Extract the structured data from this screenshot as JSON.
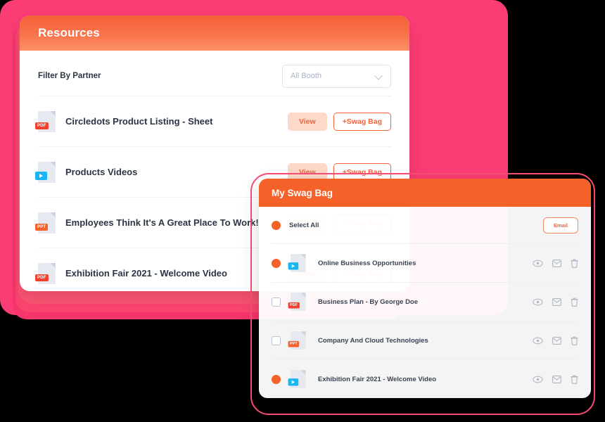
{
  "colors": {
    "pink_bg": "#FC3D75",
    "orange_header": "#F4622A",
    "accent": "#F4623A",
    "view_btn_bg": "#FDD9C9",
    "video_badge": "#18B6F2",
    "pdf_badge": "#F0402F",
    "ppt_badge": "#F4622A"
  },
  "resources": {
    "title": "Resources",
    "filter_label": "Filter By Partner",
    "filter_select": {
      "value": "All Booth",
      "placeholder": "All Booth",
      "chevron": "chevron-down-icon"
    },
    "view_label": "View",
    "swag_label": "+Swag Bag",
    "rows": [
      {
        "title": "Circledots Product Listing - Sheet",
        "type": "PDF",
        "icon": "pdf-file-icon"
      },
      {
        "title": "Products Videos",
        "type": "VIDEO",
        "icon": "video-file-icon"
      },
      {
        "title": "Employees Think It's A Great Place To Work!",
        "type": "PPT",
        "icon": "ppt-file-icon"
      },
      {
        "title": "Exhibition Fair 2021 - Welcome Video",
        "type": "PDF",
        "icon": "pdf-file-icon"
      }
    ]
  },
  "swagbag": {
    "title": "My Swag Bag",
    "select_all_label": "Select All",
    "email_label": "Email",
    "action_icons": [
      "eye-icon",
      "envelope-icon",
      "trash-icon"
    ],
    "rows": [
      {
        "title": "Online Business Opportunities",
        "type": "VIDEO",
        "icon": "video-file-icon",
        "checked": true
      },
      {
        "title": "Business Plan - By George Doe",
        "type": "PDF",
        "icon": "pdf-file-icon",
        "checked": false
      },
      {
        "title": "Company And Cloud Technologies",
        "type": "PPT",
        "icon": "ppt-file-icon",
        "checked": false
      },
      {
        "title": "Exhibition Fair 2021 - Welcome Video",
        "type": "VIDEO",
        "icon": "video-file-icon",
        "checked": true
      }
    ]
  }
}
